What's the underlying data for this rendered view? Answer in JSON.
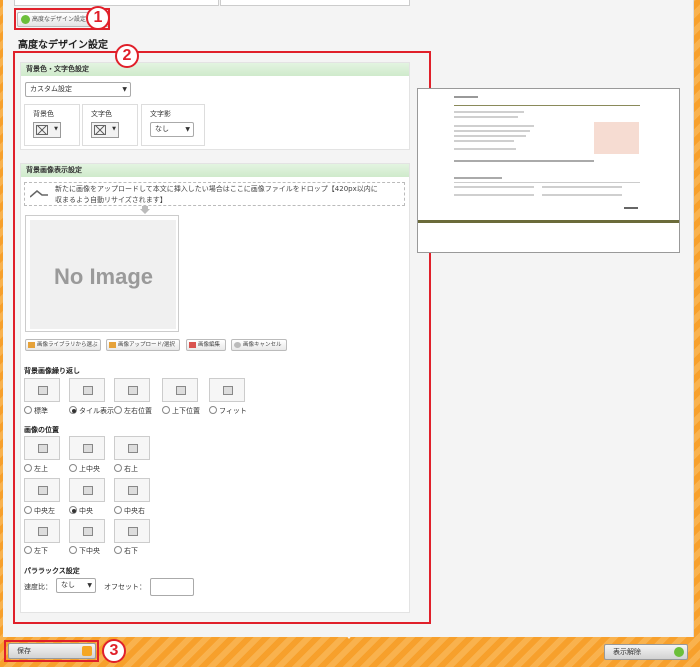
{
  "toolbar": {
    "advanced_design_button": "高度なデザイン設定"
  },
  "markers": {
    "m1": "1",
    "m2": "2",
    "m3": "3"
  },
  "section_title": "高度なデザイン設定",
  "bg_text_color": {
    "header": "背景色・文字色設定",
    "preset": "カスタム設定",
    "bg_color_label": "背景色",
    "text_color_label": "文字色",
    "text_shadow_label": "文字影",
    "text_shadow_value": "なし"
  },
  "bg_image": {
    "header": "背景画像表示設定",
    "drop_text": "新たに画像をアップロードして本文に挿入したい場合はここに画像ファイルをドロップ【420px以内に\n収まるよう自動リサイズされます】",
    "no_image": "No Image",
    "btn_library": "画像ライブラリから選ぶ",
    "btn_upload": "画像アップロード/選択",
    "btn_edit": "画像編集",
    "btn_cancel": "画像キャンセル"
  },
  "repeat": {
    "label": "背景画像繰り返し",
    "options": [
      "標準",
      "タイル表示",
      "左右位置",
      "上下位置",
      "フィット"
    ],
    "selected": 1
  },
  "position": {
    "label": "画像の位置",
    "options": [
      "左上",
      "上中央",
      "右上",
      "中央左",
      "中央",
      "中央右",
      "左下",
      "下中央",
      "右下"
    ],
    "selected": 4
  },
  "parallax": {
    "label": "パララックス設定",
    "speed_label": "速度比：",
    "speed_value": "なし",
    "offset_label": "オフセット："
  },
  "footer": {
    "save": "保存",
    "hide": "表示解除"
  }
}
